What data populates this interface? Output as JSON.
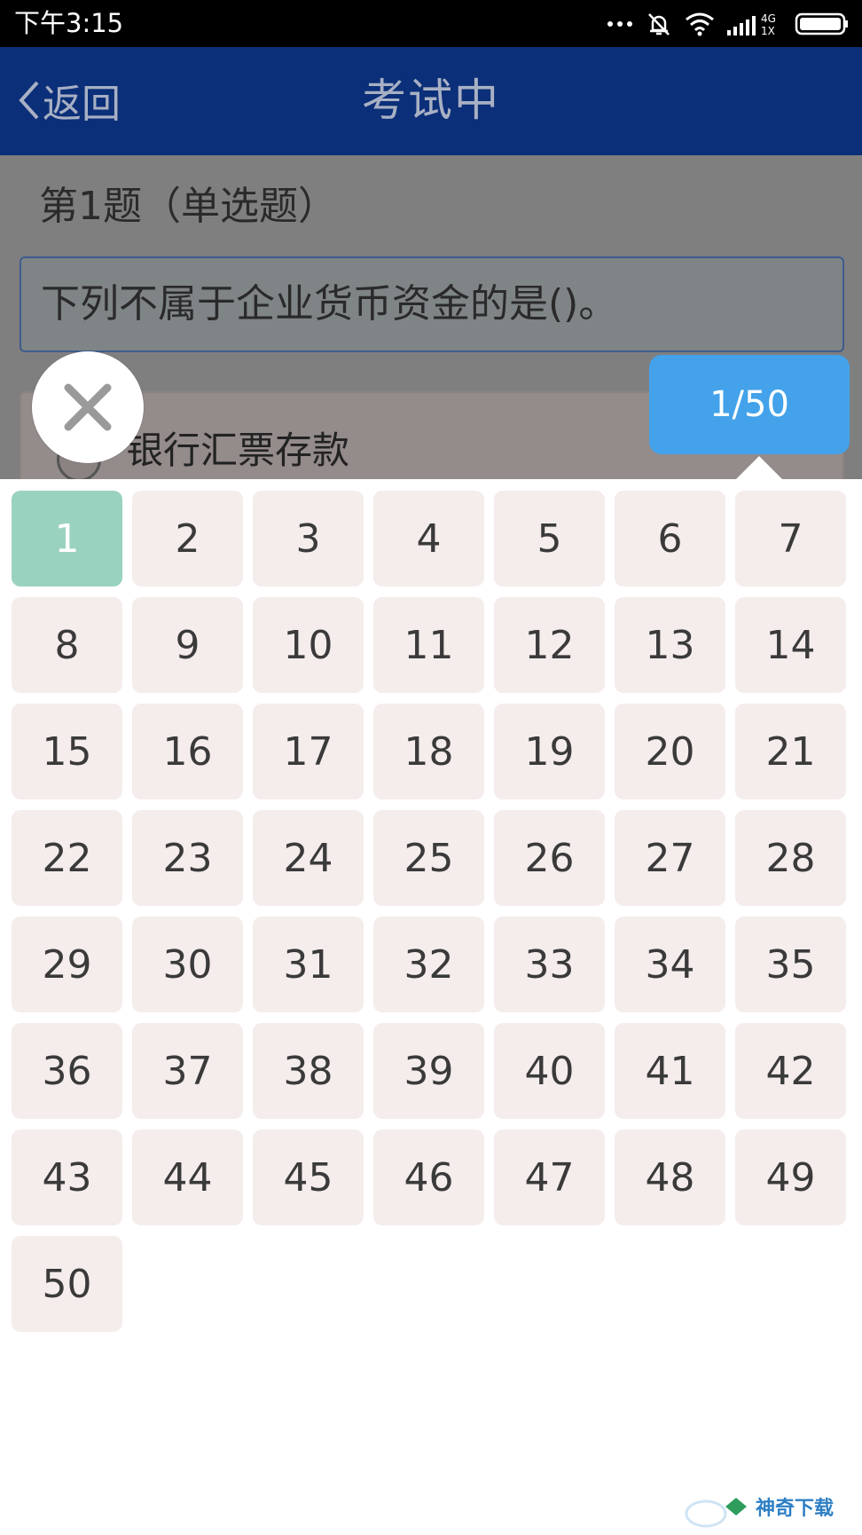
{
  "status_bar": {
    "time": "下午3:15",
    "network": "4G 1X",
    "icons": [
      "more-dots-icon",
      "mute-icon",
      "wifi-icon",
      "signal-icon",
      "battery-icon"
    ]
  },
  "nav": {
    "back_label": "返回",
    "title": "考试中"
  },
  "question": {
    "type_label": "第1题（单选题）",
    "text": "下列不属于企业货币资金的是()。",
    "options": [
      "银行汇票存款"
    ]
  },
  "progress": {
    "label": "1/50",
    "current": 1,
    "total": 50
  },
  "grid": {
    "current": 1,
    "numbers": [
      "1",
      "2",
      "3",
      "4",
      "5",
      "6",
      "7",
      "8",
      "9",
      "10",
      "11",
      "12",
      "13",
      "14",
      "15",
      "16",
      "17",
      "18",
      "19",
      "20",
      "21",
      "22",
      "23",
      "24",
      "25",
      "26",
      "27",
      "28",
      "29",
      "30",
      "31",
      "32",
      "33",
      "34",
      "35",
      "36",
      "37",
      "38",
      "39",
      "40",
      "41",
      "42",
      "43",
      "44",
      "45",
      "46",
      "47",
      "48",
      "49",
      "50"
    ]
  },
  "watermark": {
    "text": "神奇下载"
  },
  "colors": {
    "nav_bg": "#0b2f78",
    "bubble": "#43a2ea",
    "current_cell": "#9ad2c0",
    "cell": "#f5ecec"
  }
}
